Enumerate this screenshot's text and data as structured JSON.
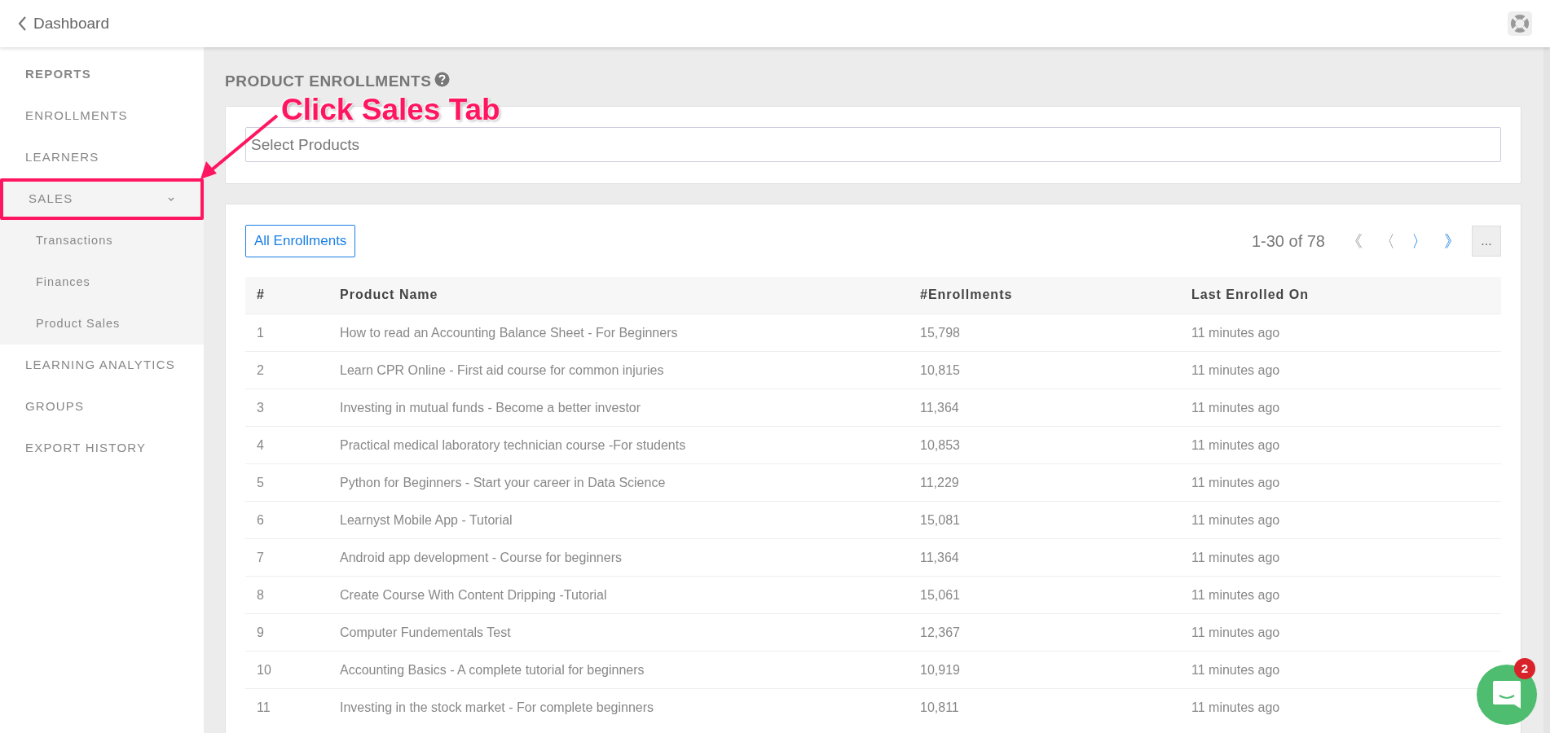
{
  "header": {
    "back_label": "Dashboard"
  },
  "sidebar": {
    "items": [
      {
        "label": "REPORTS",
        "kind": "heading"
      },
      {
        "label": "ENROLLMENTS",
        "kind": "link"
      },
      {
        "label": "LEARNERS",
        "kind": "link"
      },
      {
        "label": "SALES",
        "kind": "group",
        "expanded": true,
        "highlighted": true,
        "children": [
          {
            "label": "Transactions"
          },
          {
            "label": "Finances"
          },
          {
            "label": "Product Sales"
          }
        ]
      },
      {
        "label": "LEARNING ANALYTICS",
        "kind": "group",
        "expanded": false
      },
      {
        "label": "GROUPS",
        "kind": "link"
      },
      {
        "label": "EXPORT HISTORY",
        "kind": "link"
      }
    ]
  },
  "page_title": "PRODUCT ENROLLMENTS",
  "product_select": {
    "placeholder": "Select Products"
  },
  "annotation": {
    "text": "Click Sales Tab"
  },
  "filter_button": "All Enrollments",
  "pagination": {
    "range": "1-30 of 78",
    "buttons": [
      {
        "symbol": "《",
        "disabled": true
      },
      {
        "symbol": "〈",
        "disabled": true
      },
      {
        "symbol": "〉",
        "disabled": false
      },
      {
        "symbol": "》",
        "disabled": false
      }
    ],
    "more": "..."
  },
  "table": {
    "columns": [
      "#",
      "Product Name",
      "#Enrollments",
      "Last Enrolled On"
    ],
    "rows": [
      [
        "1",
        "How to read an Accounting Balance Sheet - For Beginners",
        "15,798",
        "11 minutes ago"
      ],
      [
        "2",
        "Learn CPR Online - First aid course for common injuries",
        "10,815",
        "11 minutes ago"
      ],
      [
        "3",
        "Investing in mutual funds - Become a better investor",
        "11,364",
        "11 minutes ago"
      ],
      [
        "4",
        "Practical medical laboratory technician course -For students",
        "10,853",
        "11 minutes ago"
      ],
      [
        "5",
        "Python for Beginners - Start your career in Data Science",
        "11,229",
        "11 minutes ago"
      ],
      [
        "6",
        "Learnyst Mobile App - Tutorial",
        "15,081",
        "11 minutes ago"
      ],
      [
        "7",
        "Android app development - Course for beginners",
        "11,364",
        "11 minutes ago"
      ],
      [
        "8",
        "Create Course With Content Dripping -Tutorial",
        "15,061",
        "11 minutes ago"
      ],
      [
        "9",
        "Computer Fundementals Test",
        "12,367",
        "11 minutes ago"
      ],
      [
        "10",
        "Accounting Basics - A complete tutorial for beginners",
        "10,919",
        "11 minutes ago"
      ],
      [
        "11",
        "Investing in the stock market - For complete beginners",
        "10,811",
        "11 minutes ago"
      ]
    ]
  },
  "chat": {
    "badge": "2"
  }
}
